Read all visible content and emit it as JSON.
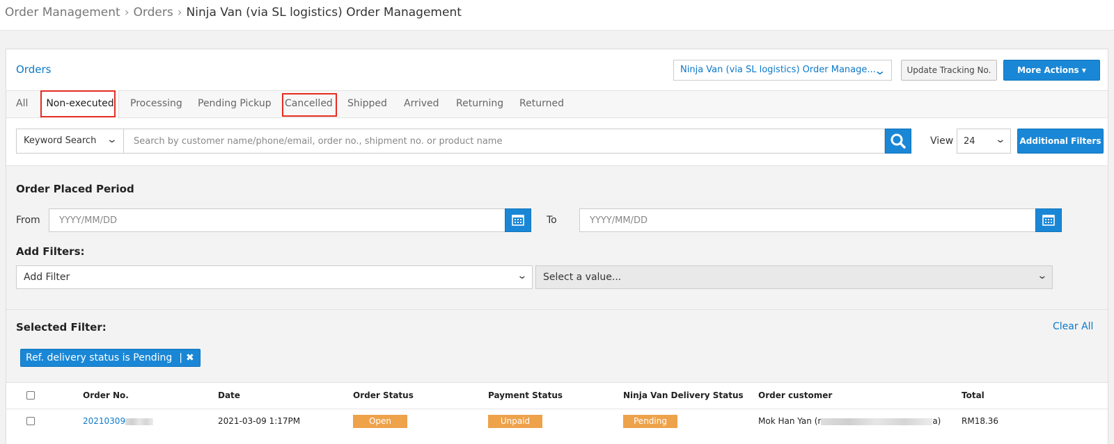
{
  "breadcrumb": {
    "items": [
      "Order Management",
      "Orders"
    ],
    "current": "Ninja Van (via SL logistics) Order Management"
  },
  "header": {
    "title": "Orders",
    "store_select": "Ninja Van (via SL logistics) Order Manage...",
    "update_tracking_label": "Update Tracking No.",
    "more_actions_label": "More Actions ▾"
  },
  "tabs": [
    "All",
    "Non-executed",
    "Processing",
    "Pending Pickup",
    "Cancelled",
    "Shipped",
    "Arrived",
    "Returning",
    "Returned"
  ],
  "search": {
    "keyword_select": "Keyword Search",
    "placeholder": "Search by customer name/phone/email, order no., shipment no. or product name",
    "view_label": "View",
    "view_value": "24",
    "additional_filters_label": "Additional Filters"
  },
  "filters": {
    "period_title": "Order Placed Period",
    "from_label": "From",
    "to_label": "To",
    "date_placeholder": "YYYY/MM/DD",
    "add_filters_title": "Add Filters:",
    "add_filter_select": "Add Filter",
    "value_select": "Select a value...",
    "selected_title": "Selected Filter:",
    "clear_all": "Clear All",
    "chip_label": "Ref. delivery status is Pending"
  },
  "table": {
    "headers": [
      "Order No.",
      "Date",
      "Order Status",
      "Payment Status",
      "Ninja Van Delivery Status",
      "Order customer",
      "Total"
    ],
    "rows": [
      {
        "order_no": "20210309",
        "date": "2021-03-09 1:17PM",
        "order_status": "Open",
        "payment_status": "Unpaid",
        "delivery_status": "Pending",
        "customer": "Mok Han Yan (r",
        "customer_suffix": "a)",
        "total": "RM18.36"
      }
    ]
  },
  "colors": {
    "accent": "#1a87d6",
    "link": "#0b79c9",
    "status_badge": "#eea24a",
    "highlight": "#e52b22"
  }
}
